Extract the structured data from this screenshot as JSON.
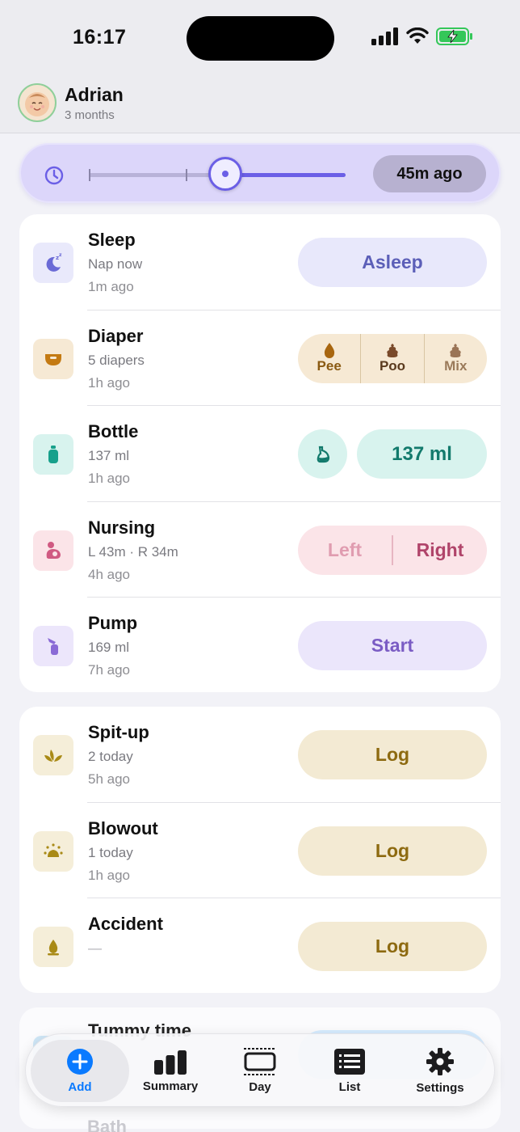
{
  "status": {
    "time": "16:17"
  },
  "header": {
    "name": "Adrian",
    "age": "3 months"
  },
  "slider": {
    "value_label": "45m ago"
  },
  "trackers": [
    {
      "title": "Sleep",
      "sub": "Nap now",
      "ago": "1m ago",
      "action": "Asleep"
    },
    {
      "title": "Diaper",
      "sub": "5 diapers",
      "ago": "1h ago",
      "options": [
        "Pee",
        "Poo",
        "Mix"
      ]
    },
    {
      "title": "Bottle",
      "sub": "137 ml",
      "ago": "1h ago",
      "action": "137 ml"
    },
    {
      "title": "Nursing",
      "sub": "L 43m · R 34m",
      "ago": "4h ago",
      "options": [
        "Left",
        "Right"
      ]
    },
    {
      "title": "Pump",
      "sub": "169 ml",
      "ago": "7h ago",
      "action": "Start"
    }
  ],
  "incidents": [
    {
      "title": "Spit-up",
      "sub": "2 today",
      "ago": "5h ago",
      "action": "Log"
    },
    {
      "title": "Blowout",
      "sub": "1 today",
      "ago": "1h ago",
      "action": "Log"
    },
    {
      "title": "Accident",
      "sub": "—",
      "action": "Log"
    }
  ],
  "more": {
    "tummy": "Tummy time",
    "bath": "Bath"
  },
  "tabs": [
    {
      "label": "Add",
      "icon": "plus-circle-icon"
    },
    {
      "label": "Summary",
      "icon": "bar-chart-icon"
    },
    {
      "label": "Day",
      "icon": "day-timeline-icon"
    },
    {
      "label": "List",
      "icon": "list-icon"
    },
    {
      "label": "Settings",
      "icon": "gear-icon"
    }
  ],
  "colors": {
    "accent": "#0a7aff",
    "slider": "#6b5fe6",
    "sleep": "#5c5fb8",
    "diaper": "#8a5a12",
    "bottle": "#127a6c",
    "nursing": "#b0446a",
    "pump": "#7a5cc4",
    "incident": "#8d6a10"
  }
}
